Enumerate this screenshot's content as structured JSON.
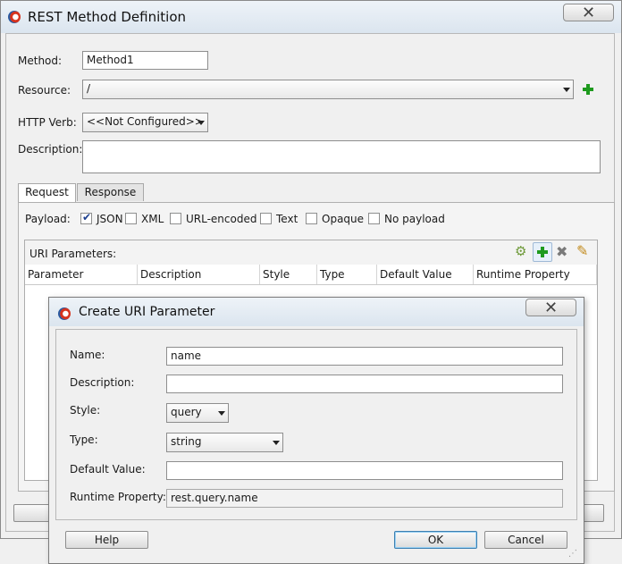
{
  "main_dialog": {
    "title": "REST Method Definition",
    "close_glyph": "✕",
    "method_label": "Method:",
    "method_value": "Method1",
    "resource_label": "Resource:",
    "resource_value": "/",
    "http_verb_label": "HTTP Verb:",
    "http_verb_value": "<<Not Configured>>",
    "description_label": "Description:",
    "description_value": "",
    "tabs": [
      {
        "label": "Request"
      },
      {
        "label": "Response"
      }
    ],
    "payload_label": "Payload:",
    "payload_options": [
      {
        "label": "JSON",
        "checked": true
      },
      {
        "label": "XML",
        "checked": false
      },
      {
        "label": "URL-encoded",
        "checked": false
      },
      {
        "label": "Text",
        "checked": false
      },
      {
        "label": "Opaque",
        "checked": false
      },
      {
        "label": "No payload",
        "checked": false
      }
    ],
    "uri_params_label": "URI Parameters:",
    "columns": [
      "Parameter",
      "Description",
      "Style",
      "Type",
      "Default Value",
      "Runtime Property"
    ]
  },
  "create_dialog": {
    "title": "Create URI Parameter",
    "close_glyph": "✕",
    "name_label": "Name:",
    "name_value": "name",
    "description_label": "Description:",
    "description_value": "",
    "style_label": "Style:",
    "style_value": "query",
    "type_label": "Type:",
    "type_value": "string",
    "default_value_label": "Default Value:",
    "default_value_value": "",
    "runtime_property_label": "Runtime Property:",
    "runtime_property_value": "rest.query.name",
    "help_label": "Help",
    "ok_label": "OK",
    "cancel_label": "Cancel"
  }
}
